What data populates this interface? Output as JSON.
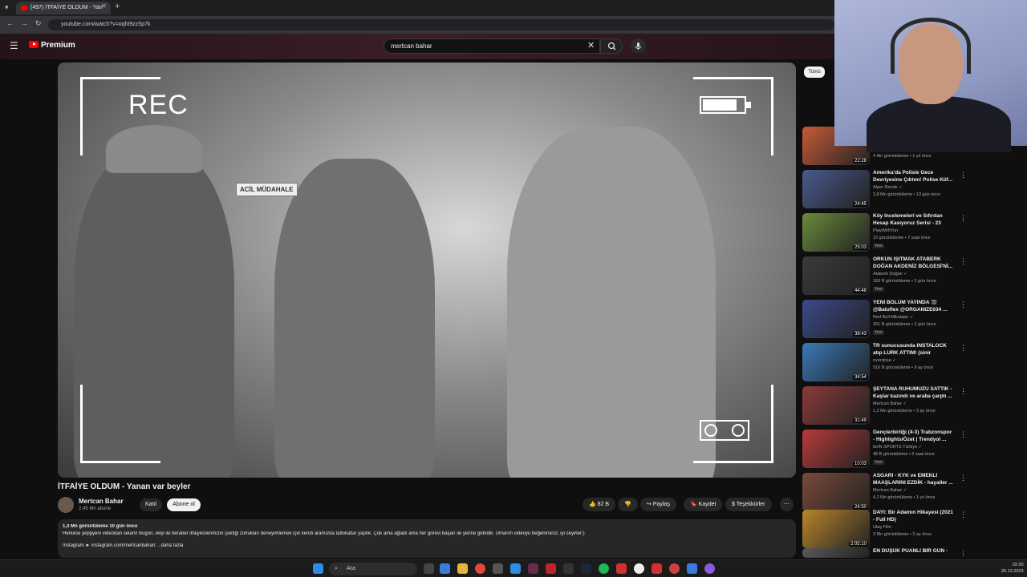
{
  "browser": {
    "tab_title": "(497) İTFAİYE OLDUM - Yan",
    "url": "youtube.com/watch?v=oqhI9zz5p7k"
  },
  "header": {
    "logo_text": "Premium",
    "search_value": "mertcan bahar"
  },
  "video": {
    "overlay_rec": "REC",
    "sign_text": "ACİL MÜDAHALE",
    "title": "İTFAİYE OLDUM - Yanan var beyler",
    "channel_name": "Mertcan Bahar",
    "subscribers": "2,45 Mn abone",
    "join_label": "Katıl",
    "subscribe_label": "Abone ol",
    "likes": "82 B",
    "share_label": "Paylaş",
    "save_label": "Kaydet",
    "thanks_label": "Teşekkürler",
    "more_label": "⋯"
  },
  "description": {
    "stats": "1,3 Mn görüntüleme  10 gün önce",
    "text": "Herkese yeppyeni videodan selam! Bugün, ekip ile beraber itfaiyecilerimizin çektiği zorlukları deneyimlemek için kendi aramızda tatbikatlar yaptık. Çok ama ağladı ama her görevi başarı ile yerine getirdik. Umarım videoyu beğenirsiniz, iyi seyirler:)",
    "link_line": "Instagram ► instagram.com/mertcanbaharr  ...daha fazla"
  },
  "sidebar": {
    "chip_label": "Tümü",
    "items": [
      {
        "title": "",
        "channel": "Mertcan Bahar ✓",
        "meta": "4 Mn görüntüleme • 1 yıl önce",
        "duration": "22:28",
        "badge": ""
      },
      {
        "title": "Amerika'da Polisle Gece Devriyesine Çıktım! Polise Küf...",
        "channel": "Alper Rende ✓",
        "meta": "3,8 Mn görüntüleme • 13 gün önce",
        "duration": "24:45",
        "badge": ""
      },
      {
        "title": "Köy İncelemeleri ve Sıfırdan Hesap Kasıyoruz Serisi - 23",
        "channel": "PlayWithYun",
        "meta": "12 görüntüleme • 7 saat önce",
        "duration": "25:03",
        "badge": "Yeni"
      },
      {
        "title": "ORKUN IŞITMAK ATABERK DOĞAN AKDENİZ BÖLGESİ'Nİ...",
        "channel": "Ataberk Doğan ✓",
        "meta": "183 B görüntüleme • 2 gün önce",
        "duration": "44:48",
        "badge": "Yeni"
      },
      {
        "title": "YENİ BÖLÜM YAYINDA 🎬 @Batuflex @ORGANIZE034 ...",
        "channel": "Red Bull Mikstape ✓",
        "meta": "301 B görüntüleme • 2 gün önce",
        "duration": "38:43",
        "badge": "Yeni"
      },
      {
        "title": "TR sunucusunda INSTALOCK atıp LURK ATTIM! (sinir krizine...",
        "channel": "overdose ✓",
        "meta": "516 B görüntüleme • 9 ay önce",
        "duration": "34:54",
        "badge": ""
      },
      {
        "title": "ŞEYTANA RUHUMUZU SATTIK - Kaşlar kazındı ve araba çarptı ...",
        "channel": "Mertcan Bahar ✓",
        "meta": "1,2 Mn görüntüleme • 3 ay önce",
        "duration": "31:49",
        "badge": ""
      },
      {
        "title": "Gençlerbirliği (4-3) Trabzonspor - Highlights/Özet | Trendyol ...",
        "channel": "beIN SPORTS Türkiye ✓",
        "meta": "48 B görüntüleme • 2 saat önce",
        "duration": "10:03",
        "badge": "Yeni"
      },
      {
        "title": "ASGARİ - KYK ve EMEKLİ MAAŞLARINI EZDİK - hayaller ...",
        "channel": "Mertcan Bahar ✓",
        "meta": "4,2 Mn görüntüleme • 1 yıl önce",
        "duration": "24:50",
        "badge": ""
      },
      {
        "title": "DAYI: Bir Adamın Hikayesi (2021 - Full HD)",
        "channel": "Ulaş Film",
        "meta": "3 Mn görüntüleme • 3 ay önce",
        "duration": "2:05:10",
        "badge": ""
      },
      {
        "title": "EN DÜŞÜK PUANLI BİR GÜN -",
        "channel": "",
        "meta": "",
        "duration": "",
        "badge": ""
      }
    ]
  },
  "taskbar": {
    "search_placeholder": "Ara",
    "time": "02:20",
    "date": "25.12.2023"
  },
  "colors": {
    "accent_red": "#ff0000",
    "background": "#0f0f0f"
  }
}
